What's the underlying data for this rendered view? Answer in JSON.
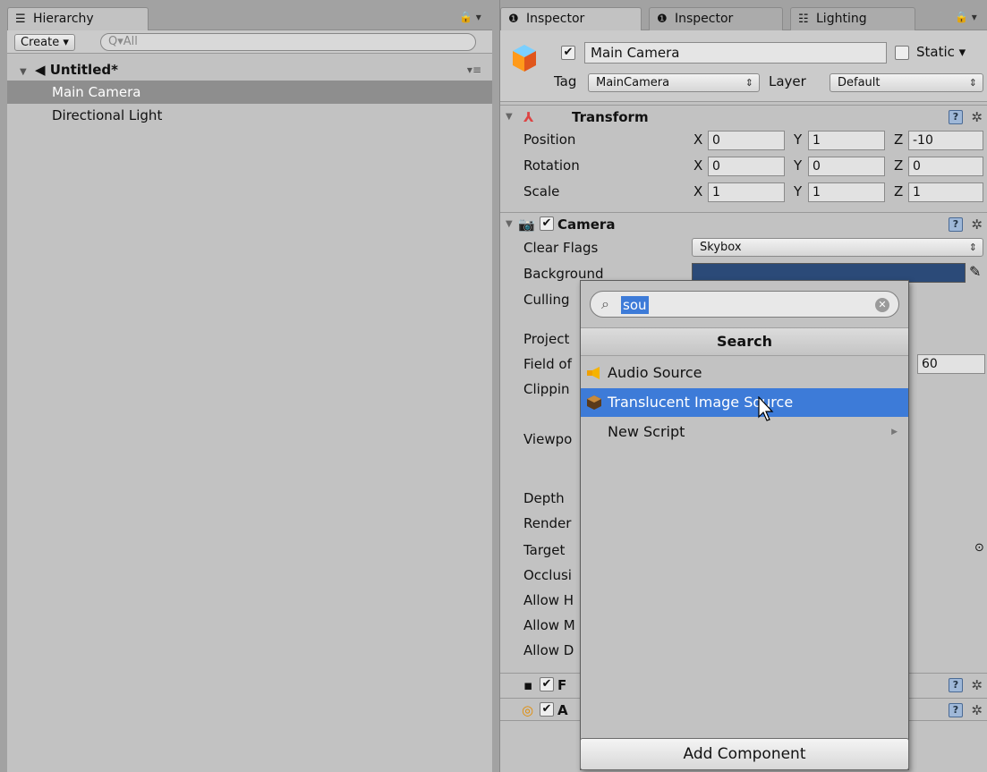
{
  "hierarchy": {
    "tab_label": "Hierarchy",
    "create_label": "Create",
    "search_placeholder": "All",
    "scene_name": "Untitled*",
    "items": [
      {
        "label": "Main Camera",
        "selected": true
      },
      {
        "label": "Directional Light",
        "selected": false
      }
    ]
  },
  "inspector": {
    "tabs": [
      {
        "label": "Inspector",
        "icon": "info-icon",
        "active": true
      },
      {
        "label": "Inspector",
        "icon": "info-icon",
        "active": false
      },
      {
        "label": "Lighting",
        "icon": "lighting-icon",
        "active": false
      }
    ],
    "object_name": "Main Camera",
    "static_label": "Static",
    "tag_label": "Tag",
    "tag_value": "MainCamera",
    "layer_label": "Layer",
    "layer_value": "Default",
    "transform": {
      "title": "Transform",
      "rows": [
        {
          "label": "Position",
          "x": "0",
          "y": "1",
          "z": "-10"
        },
        {
          "label": "Rotation",
          "x": "0",
          "y": "0",
          "z": "0"
        },
        {
          "label": "Scale",
          "x": "1",
          "y": "1",
          "z": "1"
        }
      ],
      "axis_x": "X",
      "axis_y": "Y",
      "axis_z": "Z"
    },
    "camera": {
      "title": "Camera",
      "clear_flags_label": "Clear Flags",
      "clear_flags_value": "Skybox",
      "background_label": "Background",
      "background_color": "#2b4a78",
      "labels_partial": [
        "Culling",
        "Project",
        "Field of",
        "Clippin",
        "Viewpo",
        "Depth",
        "Render",
        "Target",
        "Occlusi",
        "Allow H",
        "Allow M",
        "Allow D"
      ],
      "fov_value": "60"
    },
    "extra_components": [
      "F",
      "A"
    ]
  },
  "popup": {
    "search_value": "sou",
    "title": "Search",
    "items": [
      {
        "label": "Audio Source",
        "icon": "audio-source-icon",
        "highlighted": false
      },
      {
        "label": "Translucent Image Source",
        "icon": "translucent-image-icon",
        "highlighted": true
      },
      {
        "label": "New Script",
        "icon": "",
        "highlighted": false,
        "submenu": true
      }
    ]
  },
  "add_component_label": "Add Component"
}
